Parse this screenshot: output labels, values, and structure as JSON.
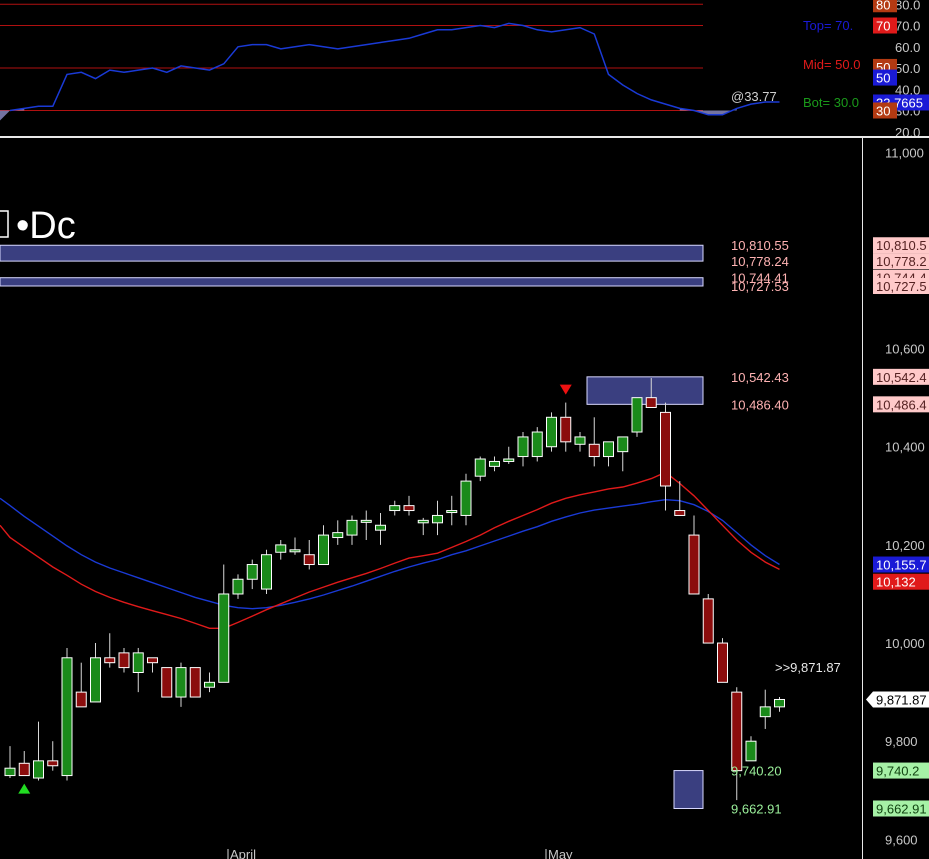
{
  "colors": {
    "background": "#000000",
    "bull_fill": "#1a8a1a",
    "bear_fill": "#8b0d0d",
    "ema_fast": "#e01a1a",
    "ema_slow": "#1a3ad6",
    "zone_fill": "#3a3f80",
    "rsi_line": "#1a3ad6",
    "axis_text": "#c8c8c8",
    "level_text": "#c8c8c8",
    "supply_tag_bg": "#ffc9c9",
    "demand_tag_bg": "#a6f1a6",
    "demand_text": "#9bf09b",
    "supply_text": "#ffb3b3"
  },
  "rsi_panel": {
    "top_label": "Top= 70.",
    "mid_label": "Mid= 50.0",
    "bot_label": "Bot= 30.0",
    "current_label": "@33.77",
    "axis_ticks": [
      "80.0",
      "70.0",
      "60.0",
      "50.0",
      "40.0",
      "30.0",
      "20.0"
    ],
    "tags": [
      {
        "text": "80",
        "bg": "#b33a12",
        "value": 80
      },
      {
        "text": "70",
        "bg": "#e01a1a",
        "value": 70
      },
      {
        "text": "50",
        "bg": "#b33a12",
        "value": 50.5
      },
      {
        "text": "50",
        "bg": "#1a1ad6",
        "value": 45.5
      },
      {
        "text": "33.7665",
        "bg": "#1a1ad6",
        "value": 33.77
      },
      {
        "text": "30",
        "bg": "#b33a12",
        "value": 30
      }
    ],
    "levels": [
      80,
      70,
      50,
      30
    ]
  },
  "price_panel": {
    "title": "•Dc",
    "axis_ticks": [
      "11,000",
      "10,600",
      "10,400",
      "10,200",
      "10,000",
      "9,800",
      "9,600"
    ],
    "x_labels": [
      "April",
      "May"
    ],
    "current_price_label": ">>9,871.87",
    "current_price_tag": "9,871.87",
    "ema_slow_tag": "10,155.7",
    "ema_fast_tag": "10,132",
    "supply_zones": [
      {
        "top": 10810.55,
        "bottom": 10778.24,
        "top_label": "10,810.55",
        "bottom_label": "10,778.24",
        "top_tag": "10,810.5",
        "bottom_tag": "10,778.2"
      },
      {
        "top": 10744.41,
        "bottom": 10727.53,
        "top_label": "10,744.41",
        "bottom_label": "10,727.53",
        "top_tag": "10,744.4",
        "bottom_tag": "10,727.5"
      },
      {
        "top": 10542.43,
        "bottom": 10486.4,
        "top_label": "10,542.43",
        "bottom_label": "10,486.40",
        "top_tag": "10,542.4",
        "bottom_tag": "10,486.4"
      }
    ],
    "demand_zones": [
      {
        "top": 9740.2,
        "bottom": 9662.91,
        "top_label": "9,740.20",
        "bottom_label": "9,662.91",
        "top_tag": "9,740.2",
        "bottom_tag": "9,662.91"
      }
    ]
  },
  "chart_data": {
    "type": "candlestick",
    "title": "•Dc",
    "y_range": [
      9560,
      11025
    ],
    "rsi_range": [
      18,
      82
    ],
    "candles": [
      {
        "o": 9730,
        "h": 9790,
        "l": 9725,
        "c": 9745
      },
      {
        "o": 9755,
        "h": 9780,
        "l": 9730,
        "c": 9730
      },
      {
        "o": 9725,
        "h": 9840,
        "l": 9720,
        "c": 9760
      },
      {
        "o": 9760,
        "h": 9800,
        "l": 9740,
        "c": 9750
      },
      {
        "o": 9730,
        "h": 9990,
        "l": 9720,
        "c": 9970
      },
      {
        "o": 9900,
        "h": 9960,
        "l": 9870,
        "c": 9870
      },
      {
        "o": 9880,
        "h": 10000,
        "l": 9880,
        "c": 9970
      },
      {
        "o": 9970,
        "h": 10020,
        "l": 9950,
        "c": 9960
      },
      {
        "o": 9980,
        "h": 9990,
        "l": 9940,
        "c": 9950
      },
      {
        "o": 9940,
        "h": 9990,
        "l": 9900,
        "c": 9980
      },
      {
        "o": 9970,
        "h": 9970,
        "l": 9940,
        "c": 9960
      },
      {
        "o": 9950,
        "h": 9950,
        "l": 9890,
        "c": 9890
      },
      {
        "o": 9890,
        "h": 9960,
        "l": 9870,
        "c": 9950
      },
      {
        "o": 9950,
        "h": 9950,
        "l": 9890,
        "c": 9890
      },
      {
        "o": 9910,
        "h": 9940,
        "l": 9900,
        "c": 9920
      },
      {
        "o": 9920,
        "h": 10160,
        "l": 9920,
        "c": 10100
      },
      {
        "o": 10100,
        "h": 10140,
        "l": 10090,
        "c": 10130
      },
      {
        "o": 10130,
        "h": 10170,
        "l": 10110,
        "c": 10160
      },
      {
        "o": 10110,
        "h": 10190,
        "l": 10100,
        "c": 10180
      },
      {
        "o": 10185,
        "h": 10210,
        "l": 10170,
        "c": 10200
      },
      {
        "o": 10190,
        "h": 10215,
        "l": 10180,
        "c": 10190
      },
      {
        "o": 10180,
        "h": 10210,
        "l": 10150,
        "c": 10160
      },
      {
        "o": 10160,
        "h": 10240,
        "l": 10160,
        "c": 10220
      },
      {
        "o": 10215,
        "h": 10250,
        "l": 10200,
        "c": 10225
      },
      {
        "o": 10220,
        "h": 10260,
        "l": 10200,
        "c": 10250
      },
      {
        "o": 10250,
        "h": 10270,
        "l": 10210,
        "c": 10250
      },
      {
        "o": 10230,
        "h": 10265,
        "l": 10200,
        "c": 10240
      },
      {
        "o": 10270,
        "h": 10290,
        "l": 10260,
        "c": 10280
      },
      {
        "o": 10280,
        "h": 10300,
        "l": 10260,
        "c": 10270
      },
      {
        "o": 10245,
        "h": 10255,
        "l": 10220,
        "c": 10250
      },
      {
        "o": 10245,
        "h": 10290,
        "l": 10220,
        "c": 10260
      },
      {
        "o": 10270,
        "h": 10300,
        "l": 10240,
        "c": 10270
      },
      {
        "o": 10260,
        "h": 10345,
        "l": 10240,
        "c": 10330
      },
      {
        "o": 10340,
        "h": 10380,
        "l": 10330,
        "c": 10375
      },
      {
        "o": 10360,
        "h": 10380,
        "l": 10350,
        "c": 10370
      },
      {
        "o": 10370,
        "h": 10400,
        "l": 10365,
        "c": 10375
      },
      {
        "o": 10380,
        "h": 10430,
        "l": 10360,
        "c": 10420
      },
      {
        "o": 10380,
        "h": 10440,
        "l": 10370,
        "c": 10430
      },
      {
        "o": 10400,
        "h": 10470,
        "l": 10390,
        "c": 10460
      },
      {
        "o": 10460,
        "h": 10490,
        "l": 10390,
        "c": 10410
      },
      {
        "o": 10405,
        "h": 10430,
        "l": 10390,
        "c": 10420
      },
      {
        "o": 10405,
        "h": 10460,
        "l": 10360,
        "c": 10380
      },
      {
        "o": 10380,
        "h": 10410,
        "l": 10360,
        "c": 10410
      },
      {
        "o": 10390,
        "h": 10420,
        "l": 10350,
        "c": 10420
      },
      {
        "o": 10430,
        "h": 10500,
        "l": 10420,
        "c": 10500
      },
      {
        "o": 10500,
        "h": 10540,
        "l": 10480,
        "c": 10480
      },
      {
        "o": 10470,
        "h": 10490,
        "l": 10270,
        "c": 10320
      },
      {
        "o": 10270,
        "h": 10330,
        "l": 10260,
        "c": 10260
      },
      {
        "o": 10220,
        "h": 10260,
        "l": 10100,
        "c": 10100
      },
      {
        "o": 10090,
        "h": 10100,
        "l": 10000,
        "c": 10000
      },
      {
        "o": 10000,
        "h": 10010,
        "l": 9920,
        "c": 9920
      },
      {
        "o": 9900,
        "h": 9910,
        "l": 9680,
        "c": 9740
      },
      {
        "o": 9760,
        "h": 9810,
        "l": 9760,
        "c": 9800
      },
      {
        "o": 9850,
        "h": 9905,
        "l": 9825,
        "c": 9870
      },
      {
        "o": 9870,
        "h": 9890,
        "l": 9860,
        "c": 9885
      }
    ],
    "ema_fast": [
      10215,
      10195,
      10175,
      10155,
      10138,
      10120,
      10105,
      10093,
      10083,
      10074,
      10066,
      10058,
      10050,
      10040,
      10030,
      10030,
      10042,
      10055,
      10068,
      10080,
      10092,
      10104,
      10114,
      10124,
      10133,
      10142,
      10152,
      10163,
      10173,
      10178,
      10183,
      10195,
      10207,
      10220,
      10235,
      10248,
      10260,
      10272,
      10285,
      10295,
      10302,
      10308,
      10314,
      10318,
      10326,
      10335,
      10348,
      10325,
      10300,
      10270,
      10240,
      10210,
      10185,
      10165,
      10150
    ],
    "ema_slow": [
      10280,
      10258,
      10238,
      10218,
      10198,
      10180,
      10165,
      10153,
      10143,
      10133,
      10123,
      10113,
      10103,
      10093,
      10085,
      10077,
      10072,
      10070,
      10072,
      10077,
      10083,
      10090,
      10098,
      10107,
      10116,
      10126,
      10136,
      10146,
      10155,
      10163,
      10170,
      10180,
      10188,
      10198,
      10208,
      10218,
      10228,
      10237,
      10248,
      10257,
      10265,
      10271,
      10275,
      10279,
      10283,
      10288,
      10292,
      10290,
      10282,
      10268,
      10250,
      10225,
      10200,
      10178,
      10160
    ],
    "rsi": [
      30,
      31,
      32,
      32,
      47,
      48,
      45,
      49,
      48,
      49,
      50,
      48,
      51,
      50,
      49,
      52,
      60,
      61,
      61,
      59,
      60,
      61,
      60,
      59,
      60,
      61,
      62,
      63,
      64,
      66,
      68,
      68,
      69,
      70,
      69,
      71,
      70,
      68,
      67,
      68,
      69,
      66,
      47,
      42,
      38,
      35,
      33,
      31,
      30,
      28,
      28,
      31,
      33,
      34,
      34
    ],
    "signals": [
      {
        "index": 1,
        "type": "buy"
      },
      {
        "index": 39,
        "type": "sell"
      }
    ]
  }
}
